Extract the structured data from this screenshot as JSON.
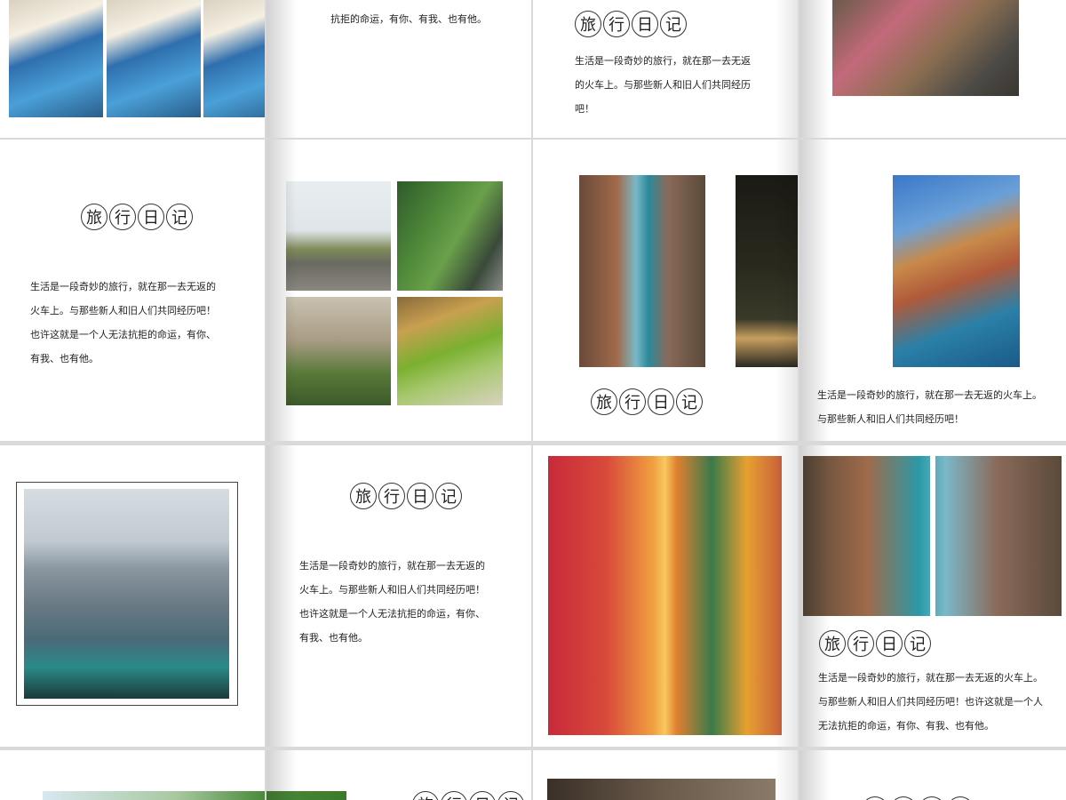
{
  "title_chars": [
    "旅",
    "行",
    "日",
    "记"
  ],
  "paragraphs": {
    "r1_s2": [
      "抗拒的命运，有你、有我、也有他。"
    ],
    "r1_s3": [
      "生活是一段奇妙的旅行，就在那一去无返",
      "的火车上。与那些新人和旧人们共同经历",
      "吧！"
    ],
    "r2_s1": [
      "生活是一段奇妙的旅行，就在那一去无返的",
      "火车上。与那些新人和旧人们共同经历吧！",
      "也许这就是一个人无法抗拒的命运，有你、",
      "有我、也有他。"
    ],
    "r2_s3": [
      "生活是一段奇妙的旅行，就在那一去无返的火车上。",
      "与那些新人和旧人们共同经历吧！"
    ],
    "r3_s2": [
      "生活是一段奇妙的旅行，就在那一去无返的",
      "火车上。与那些新人和旧人们共同经历吧！",
      "也许这就是一个人无法抗拒的命运，有你、",
      "有我、也有他。"
    ],
    "r3_s4": [
      "生活是一段奇妙的旅行，就在那一去无返的火车上。",
      "与那些新人和旧人们共同经历吧！也许这就是一个人",
      "无法抗拒的命运，有你、有我、也有他。"
    ]
  }
}
